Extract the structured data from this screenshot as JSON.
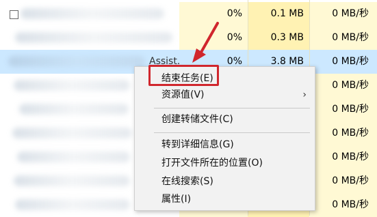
{
  "table": {
    "rows": [
      {
        "cpu": "0%",
        "memory": "0.1 MB",
        "disk": "0 MB/秒",
        "has_checkbox": true
      },
      {
        "cpu": "0%",
        "memory": "0.3 MB",
        "disk": "0 MB/秒"
      },
      {
        "name_partial": "Assist...",
        "cpu": "0%",
        "memory": "3.8 MB",
        "disk": "0 MB/秒",
        "selected": true
      },
      {
        "disk": "0 MB/秒"
      },
      {
        "disk": "0 MB/秒"
      },
      {
        "disk": "0 MB/秒"
      },
      {
        "disk": "0 MB/秒"
      },
      {
        "disk": "0 MB/秒"
      },
      {
        "disk": "0 MB/秒"
      }
    ]
  },
  "context_menu": {
    "end_task": "结束任务(E)",
    "resource_values": "资源值(V)",
    "submenu_arrow": "›",
    "create_dump": "创建转储文件(C)",
    "go_to_details": "转到详细信息(G)",
    "open_file_location": "打开文件所在的位置(O)",
    "search_online": "在线搜索(S)",
    "properties": "属性(I)"
  },
  "annotation": {
    "color": "#d0262d",
    "target": "end_task"
  },
  "colors": {
    "selected_row": "#cce8ff",
    "heat_light": "#fff9d4",
    "heat_mid": "#fff2b3"
  }
}
